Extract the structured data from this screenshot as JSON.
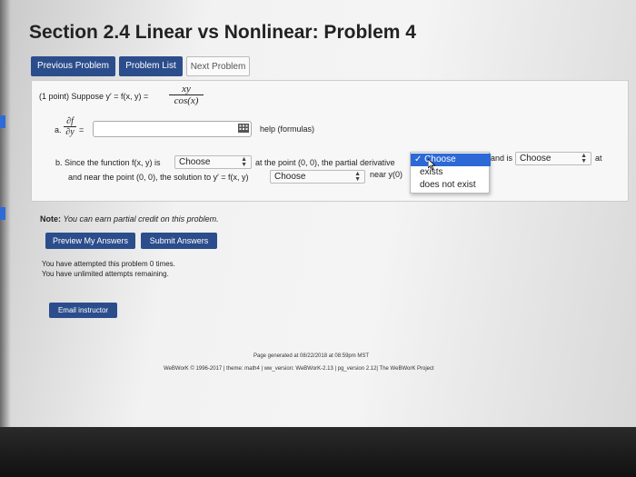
{
  "page_title": "Section 2.4 Linear vs Nonlinear: Problem 4",
  "nav": {
    "previous": "Previous Problem",
    "list": "Problem List",
    "next": "Next Problem"
  },
  "problem": {
    "intro": "(1 point) Suppose y′ = f(x, y) =",
    "fraction_num": "xy",
    "fraction_den": "cos(x)",
    "part_a_label": "a.",
    "part_a_num": "∂f",
    "part_a_den": "∂y",
    "part_a_eq": "=",
    "answer_value": "",
    "help_link": "help (formulas)",
    "part_b_start": "b. Since the function f(x, y) is",
    "part_b_mid": "at the point (0, 0), the partial derivative",
    "part_b_and_is": "and is",
    "part_b_at": "at",
    "part_b_line2": "and near the point (0, 0), the solution to y′ = f(x, y)",
    "part_b_near": "near y(0)",
    "select_choose": "Choose"
  },
  "dropdown": {
    "options": [
      "Choose",
      "exists",
      "does not exist"
    ],
    "selected": "Choose"
  },
  "note": {
    "label": "Note:",
    "text": "You can earn partial credit on this problem."
  },
  "actions": {
    "preview": "Preview My Answers",
    "submit": "Submit Answers"
  },
  "attempts": {
    "line1": "You have attempted this problem 0 times.",
    "line2": "You have unlimited attempts remaining."
  },
  "email_button": "Email instructor",
  "footer": {
    "generated": "Page generated at 08/22/2018 at 08:59pm MST",
    "version": "WeBWorK © 1996-2017 | theme: math4 | ww_version: WeBWorK-2.13 | pg_version 2.12| The WeBWorK Project"
  },
  "colors": {
    "primary_button": "#2c4d8c",
    "dropdown_highlight": "#2c69d6"
  }
}
